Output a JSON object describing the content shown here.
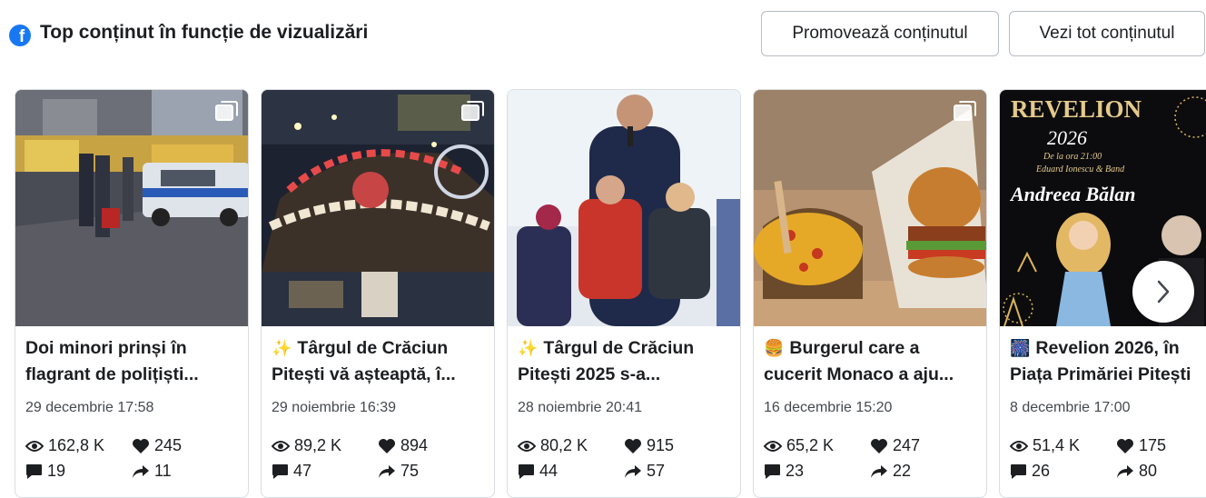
{
  "header": {
    "title": "Top conținut în funcție de vizualizări",
    "brand_icon": "facebook-icon",
    "brand_color": "#1877f2",
    "promote_label": "Promovează conținutul",
    "view_all_label": "Vezi tot conținutul"
  },
  "posts": [
    {
      "emoji": "",
      "title_line1": "Doi minori prinși în",
      "title_line2": "flagrant de polițiști...",
      "date": "29 decembrie 17:58",
      "views": "162,8 K",
      "likes": "245",
      "comments": "19",
      "shares": "11"
    },
    {
      "emoji": "✨",
      "title_line1": "Târgul de Crăciun",
      "title_line2": "Pitești vă așteaptă, î...",
      "date": "29 noiembrie 16:39",
      "views": "89,2 K",
      "likes": "894",
      "comments": "47",
      "shares": "75"
    },
    {
      "emoji": "✨",
      "title_line1": "Târgul de Crăciun",
      "title_line2": "Pitești 2025 s-a...",
      "date": "28 noiembrie 20:41",
      "views": "80,2 K",
      "likes": "915",
      "comments": "44",
      "shares": "57"
    },
    {
      "emoji": "🍔",
      "title_line1": "Burgerul care a",
      "title_line2": "cucerit Monaco a aju...",
      "date": "16 decembrie 15:20",
      "views": "65,2 K",
      "likes": "247",
      "comments": "23",
      "shares": "22"
    },
    {
      "emoji": "🎆",
      "title_line1": "Revelion 2026, în",
      "title_line2": "Piața Primăriei Pitești",
      "date": "8 decembrie 17:00",
      "views": "51,4 K",
      "likes": "175",
      "comments": "26",
      "shares": "80"
    }
  ],
  "poster": {
    "headline": "REVELION",
    "year": "2026",
    "time": "De la ora 21:00",
    "guest": "Eduard Ionescu & Band",
    "artist": "Andreea Bălan"
  },
  "icons": {
    "views": "eye-icon",
    "likes": "heart-icon",
    "comments": "comment-icon",
    "shares": "share-arrow-icon",
    "next": "chevron-right-icon",
    "multi_photo": "multi-photo-icon"
  }
}
